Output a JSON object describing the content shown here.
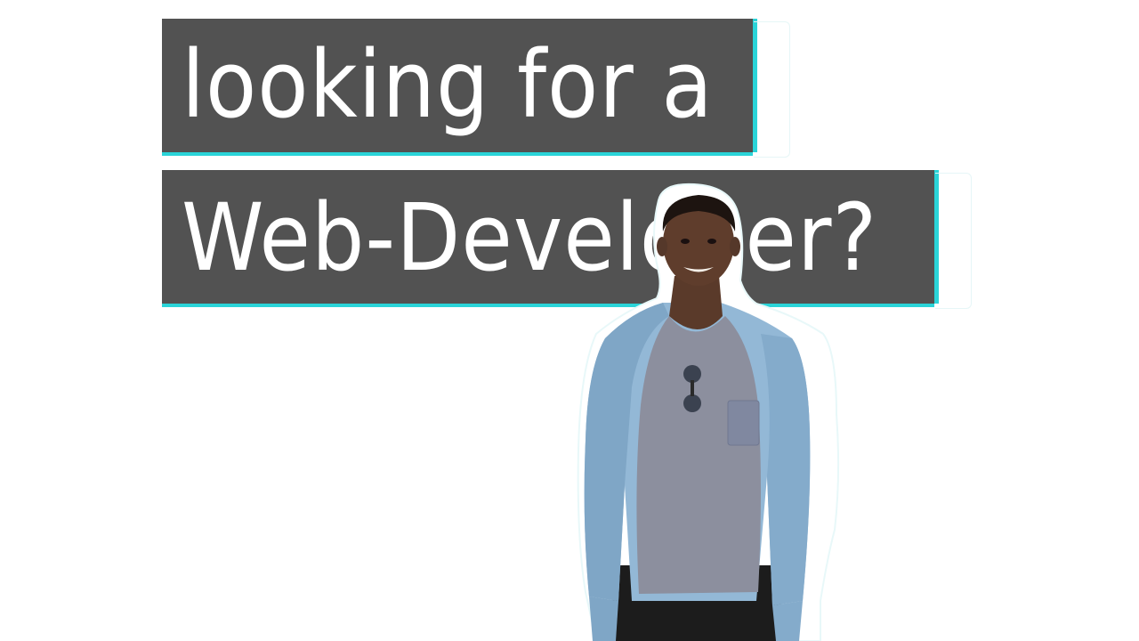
{
  "headline": {
    "line1": "looking for a",
    "line2": "Web-Developer?"
  },
  "colors": {
    "banner_bg": "#525252",
    "accent": "#2ad4d8",
    "text": "#ffffff",
    "page_bg": "#ffffff"
  },
  "image": {
    "icon": "person-photo"
  }
}
